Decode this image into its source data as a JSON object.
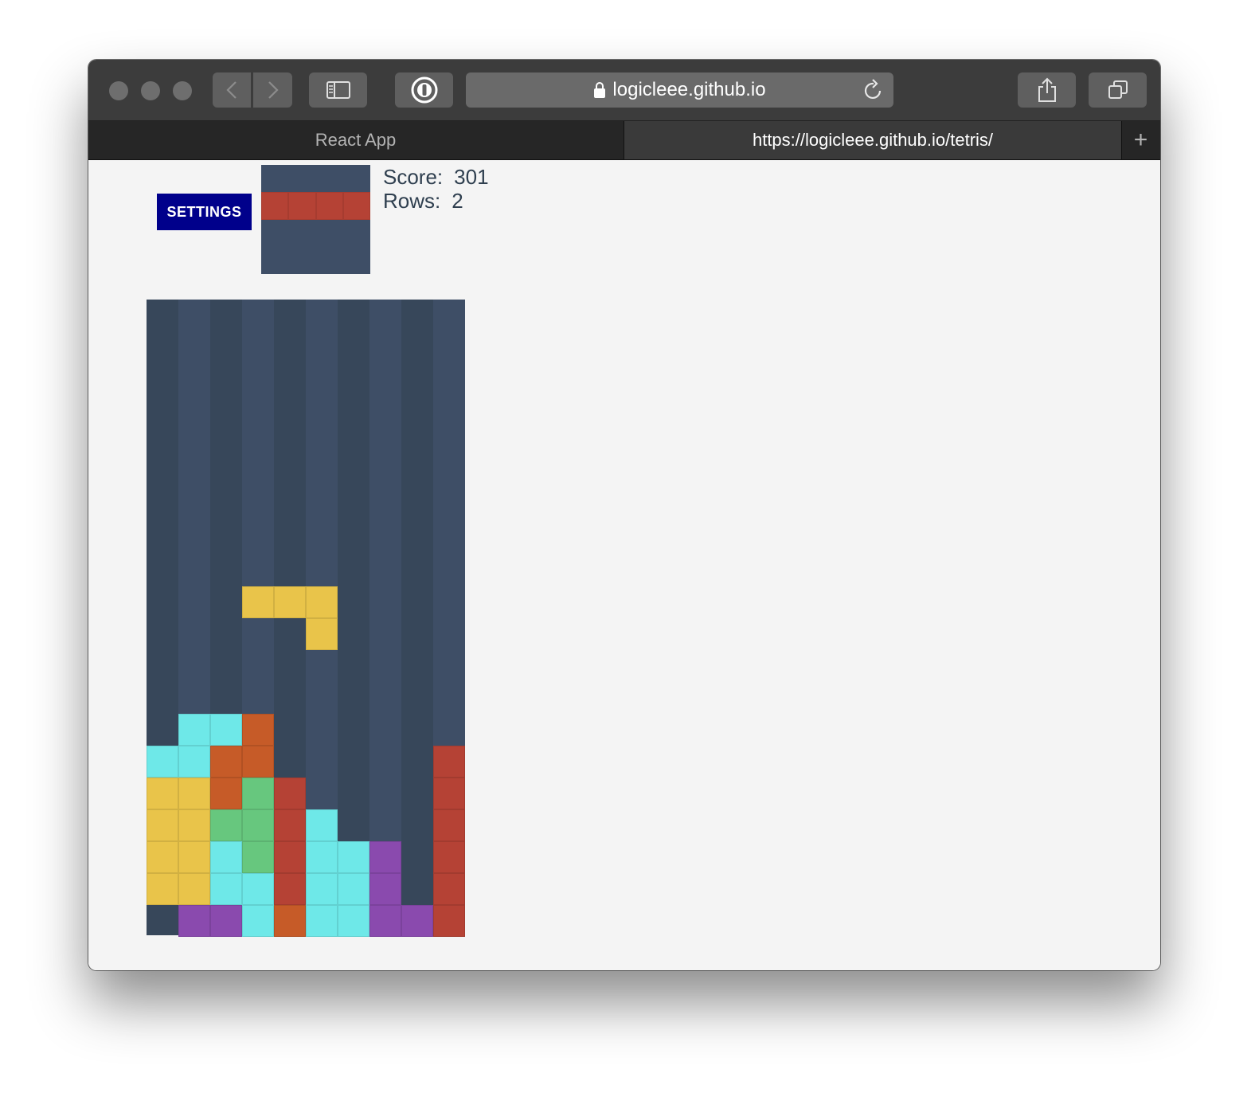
{
  "browser": {
    "url_display": "logicleee.github.io",
    "tabs": [
      {
        "label": "React App",
        "active": false
      },
      {
        "label": "https://logicleee.github.io/tetris/",
        "active": true
      }
    ],
    "new_tab_label": "+"
  },
  "game": {
    "settings_label": "SETTINGS",
    "score_label": "Score:",
    "score_value": "301",
    "rows_label": "Rows:",
    "rows_value": "2",
    "colors": {
      "I": "#b54235",
      "O": "#e9c44a",
      "L": "#6ee8e8",
      "J": "#c65b28",
      "S": "#67c77e",
      "T": "#8a4aae",
      "board_dark": "#37475a",
      "board_light": "#3e4e66",
      "settings_bg": "#00008b"
    },
    "next_piece": {
      "columns": 4,
      "rows": 4,
      "cells": [
        {
          "col": 0,
          "row": 1,
          "type": "I"
        },
        {
          "col": 1,
          "row": 1,
          "type": "I"
        },
        {
          "col": 2,
          "row": 1,
          "type": "I"
        },
        {
          "col": 3,
          "row": 1,
          "type": "I"
        }
      ]
    },
    "board": {
      "columns": 10,
      "rows": 20,
      "active_piece": [
        {
          "col": 3,
          "row": 9,
          "type": "O"
        },
        {
          "col": 4,
          "row": 9,
          "type": "O"
        },
        {
          "col": 5,
          "row": 9,
          "type": "O"
        },
        {
          "col": 5,
          "row": 10,
          "type": "O"
        }
      ],
      "locked_cells": [
        {
          "col": 1,
          "row": 13,
          "type": "L"
        },
        {
          "col": 2,
          "row": 13,
          "type": "L"
        },
        {
          "col": 3,
          "row": 13,
          "type": "J"
        },
        {
          "col": 0,
          "row": 14,
          "type": "L"
        },
        {
          "col": 1,
          "row": 14,
          "type": "L"
        },
        {
          "col": 2,
          "row": 14,
          "type": "J"
        },
        {
          "col": 3,
          "row": 14,
          "type": "J"
        },
        {
          "col": 9,
          "row": 14,
          "type": "I"
        },
        {
          "col": 0,
          "row": 15,
          "type": "O"
        },
        {
          "col": 1,
          "row": 15,
          "type": "O"
        },
        {
          "col": 2,
          "row": 15,
          "type": "J"
        },
        {
          "col": 3,
          "row": 15,
          "type": "S"
        },
        {
          "col": 4,
          "row": 15,
          "type": "I"
        },
        {
          "col": 9,
          "row": 15,
          "type": "I"
        },
        {
          "col": 0,
          "row": 16,
          "type": "O"
        },
        {
          "col": 1,
          "row": 16,
          "type": "O"
        },
        {
          "col": 2,
          "row": 16,
          "type": "S"
        },
        {
          "col": 3,
          "row": 16,
          "type": "S"
        },
        {
          "col": 4,
          "row": 16,
          "type": "I"
        },
        {
          "col": 5,
          "row": 16,
          "type": "L"
        },
        {
          "col": 9,
          "row": 16,
          "type": "I"
        },
        {
          "col": 0,
          "row": 17,
          "type": "O"
        },
        {
          "col": 1,
          "row": 17,
          "type": "O"
        },
        {
          "col": 2,
          "row": 17,
          "type": "L"
        },
        {
          "col": 3,
          "row": 17,
          "type": "S"
        },
        {
          "col": 4,
          "row": 17,
          "type": "I"
        },
        {
          "col": 5,
          "row": 17,
          "type": "L"
        },
        {
          "col": 6,
          "row": 17,
          "type": "L"
        },
        {
          "col": 7,
          "row": 17,
          "type": "T"
        },
        {
          "col": 9,
          "row": 17,
          "type": "I"
        },
        {
          "col": 0,
          "row": 18,
          "type": "O"
        },
        {
          "col": 1,
          "row": 18,
          "type": "O"
        },
        {
          "col": 2,
          "row": 18,
          "type": "L"
        },
        {
          "col": 3,
          "row": 18,
          "type": "L"
        },
        {
          "col": 4,
          "row": 18,
          "type": "I"
        },
        {
          "col": 5,
          "row": 18,
          "type": "L"
        },
        {
          "col": 6,
          "row": 18,
          "type": "L"
        },
        {
          "col": 7,
          "row": 18,
          "type": "T"
        },
        {
          "col": 9,
          "row": 18,
          "type": "I"
        },
        {
          "col": 1,
          "row": 19,
          "type": "T"
        },
        {
          "col": 2,
          "row": 19,
          "type": "T"
        },
        {
          "col": 3,
          "row": 19,
          "type": "L"
        },
        {
          "col": 4,
          "row": 19,
          "type": "J"
        },
        {
          "col": 5,
          "row": 19,
          "type": "L"
        },
        {
          "col": 6,
          "row": 19,
          "type": "L"
        },
        {
          "col": 7,
          "row": 19,
          "type": "T"
        },
        {
          "col": 8,
          "row": 19,
          "type": "T"
        },
        {
          "col": 9,
          "row": 19,
          "type": "I"
        }
      ]
    }
  }
}
